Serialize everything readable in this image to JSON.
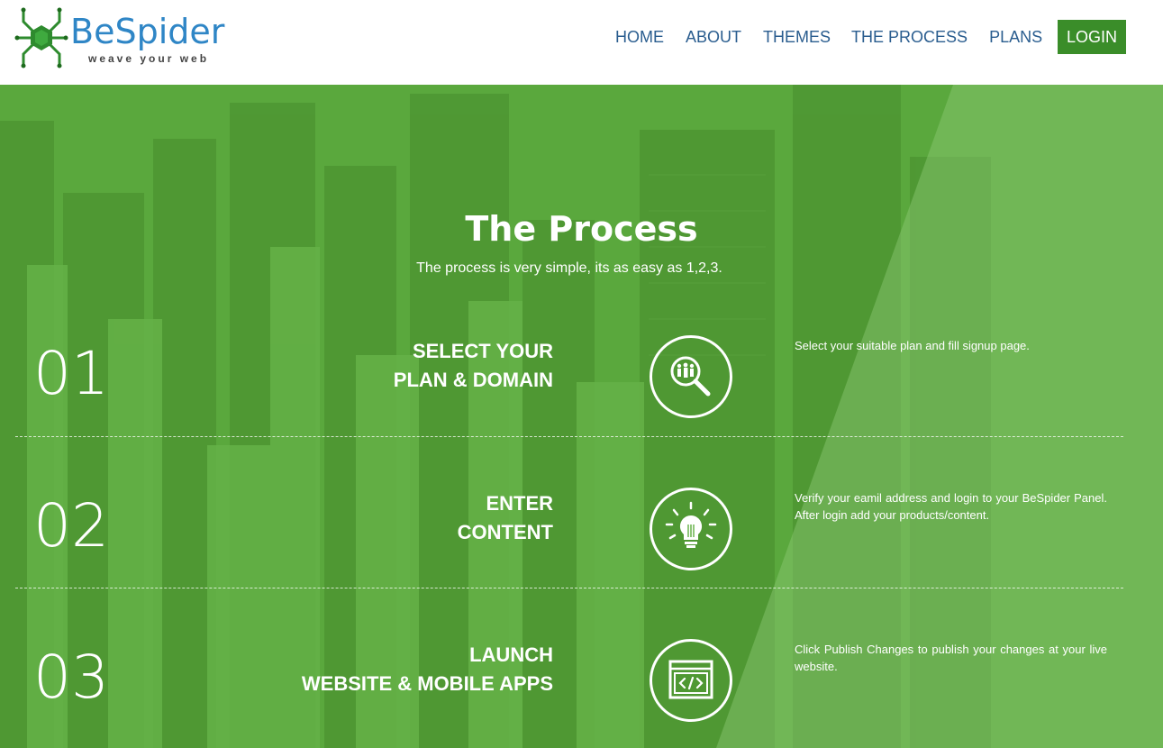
{
  "brand": {
    "name": "BeSpider",
    "tagline": "weave your web"
  },
  "nav": {
    "items": [
      {
        "label": "HOME"
      },
      {
        "label": "ABOUT"
      },
      {
        "label": "THEMES"
      },
      {
        "label": "THE PROCESS"
      },
      {
        "label": "PLANS"
      }
    ],
    "login_label": "LOGIN"
  },
  "process": {
    "title": "The Process",
    "subtitle": "The process is very simple, its as easy as 1,2,3.",
    "steps": [
      {
        "number": "01",
        "title_line1": "SELECT YOUR",
        "title_line2": "PLAN & DOMAIN",
        "icon": "search-people-icon",
        "description": "Select your suitable plan and fill signup page."
      },
      {
        "number": "02",
        "title_line1": "ENTER",
        "title_line2": "CONTENT",
        "icon": "lightbulb-icon",
        "description": "Verify your eamil address and login to your BeSpider Panel. After login add your products/content."
      },
      {
        "number": "03",
        "title_line1": "LAUNCH",
        "title_line2": "WEBSITE & MOBILE APPS",
        "icon": "code-window-icon",
        "description": "Click Publish Changes to publish your changes at your live website."
      }
    ]
  },
  "colors": {
    "brand_blue": "#2f86c6",
    "nav_text": "#2a5d8f",
    "login_green": "#3a8d29",
    "hero_green": "#5fae42"
  }
}
